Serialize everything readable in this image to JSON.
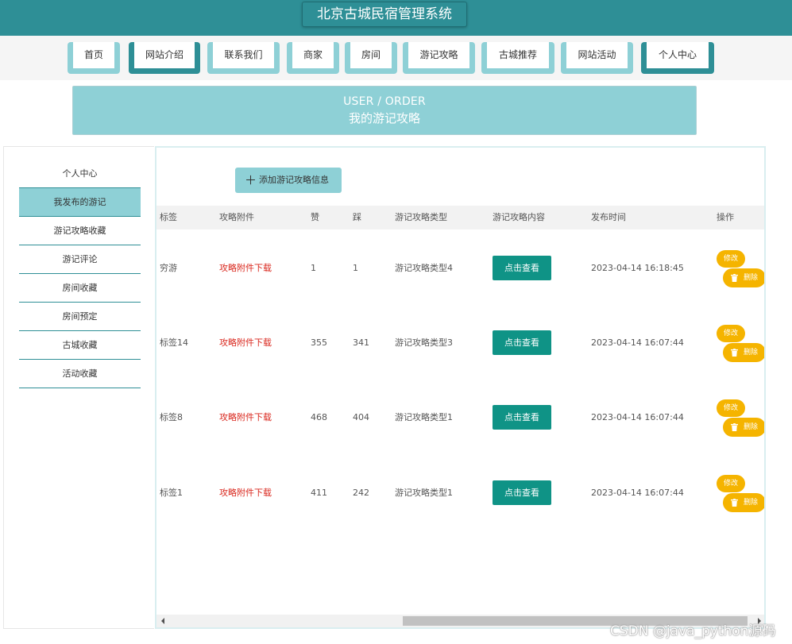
{
  "site": {
    "title": "北京古城民宿管理系统"
  },
  "nav": {
    "items": [
      {
        "label": "首页"
      },
      {
        "label": "网站介绍"
      },
      {
        "label": "联系我们"
      },
      {
        "label": "商家"
      },
      {
        "label": "房间"
      },
      {
        "label": "游记攻略"
      },
      {
        "label": "古城推荐"
      },
      {
        "label": "网站活动"
      },
      {
        "label": "个人中心"
      }
    ]
  },
  "banner": {
    "en": "USER / ORDER",
    "cn": "我的游记攻略"
  },
  "sidebar": {
    "items": [
      {
        "label": "个人中心"
      },
      {
        "label": "我发布的游记"
      },
      {
        "label": "游记攻略收藏"
      },
      {
        "label": "游记评论"
      },
      {
        "label": "房间收藏"
      },
      {
        "label": "房间预定"
      },
      {
        "label": "古城收藏"
      },
      {
        "label": "活动收藏"
      }
    ],
    "active": "我发布的游记"
  },
  "toolbar": {
    "add_label": "添加游记攻略信息"
  },
  "table": {
    "headers": [
      "标签",
      "攻略附件",
      "赞",
      "踩",
      "游记攻略类型",
      "游记攻略内容",
      "发布时间",
      "操作"
    ],
    "rows": [
      {
        "tag": "穷游",
        "attachment": "攻略附件下载",
        "likes": "1",
        "dislikes": "1",
        "type": "游记攻略类型4",
        "view": "点击查看",
        "time": "2023-04-14 16:18:45",
        "edit": "修改",
        "delete": "删除"
      },
      {
        "tag": "标签14",
        "attachment": "攻略附件下载",
        "likes": "355",
        "dislikes": "341",
        "type": "游记攻略类型3",
        "view": "点击查看",
        "time": "2023-04-14 16:07:44",
        "edit": "修改",
        "delete": "删除"
      },
      {
        "tag": "标签8",
        "attachment": "攻略附件下载",
        "likes": "468",
        "dislikes": "404",
        "type": "游记攻略类型1",
        "view": "点击查看",
        "time": "2023-04-14 16:07:44",
        "edit": "修改",
        "delete": "删除"
      },
      {
        "tag": "标签1",
        "attachment": "攻略附件下载",
        "likes": "411",
        "dislikes": "242",
        "type": "游记攻略类型1",
        "view": "点击查看",
        "time": "2023-04-14 16:07:44",
        "edit": "修改",
        "delete": "删除"
      }
    ]
  },
  "watermark": "CSDN @java_python源码",
  "colors": {
    "primary": "#2e8f96",
    "light": "#8ed0d6",
    "view_button": "#0f9386",
    "action_button": "#f5b400",
    "link": "#d9261c"
  },
  "icons": {
    "add": "plus-icon",
    "delete": "trash-icon",
    "scroll_left": "chevron-left-icon",
    "scroll_right": "chevron-right-icon"
  }
}
